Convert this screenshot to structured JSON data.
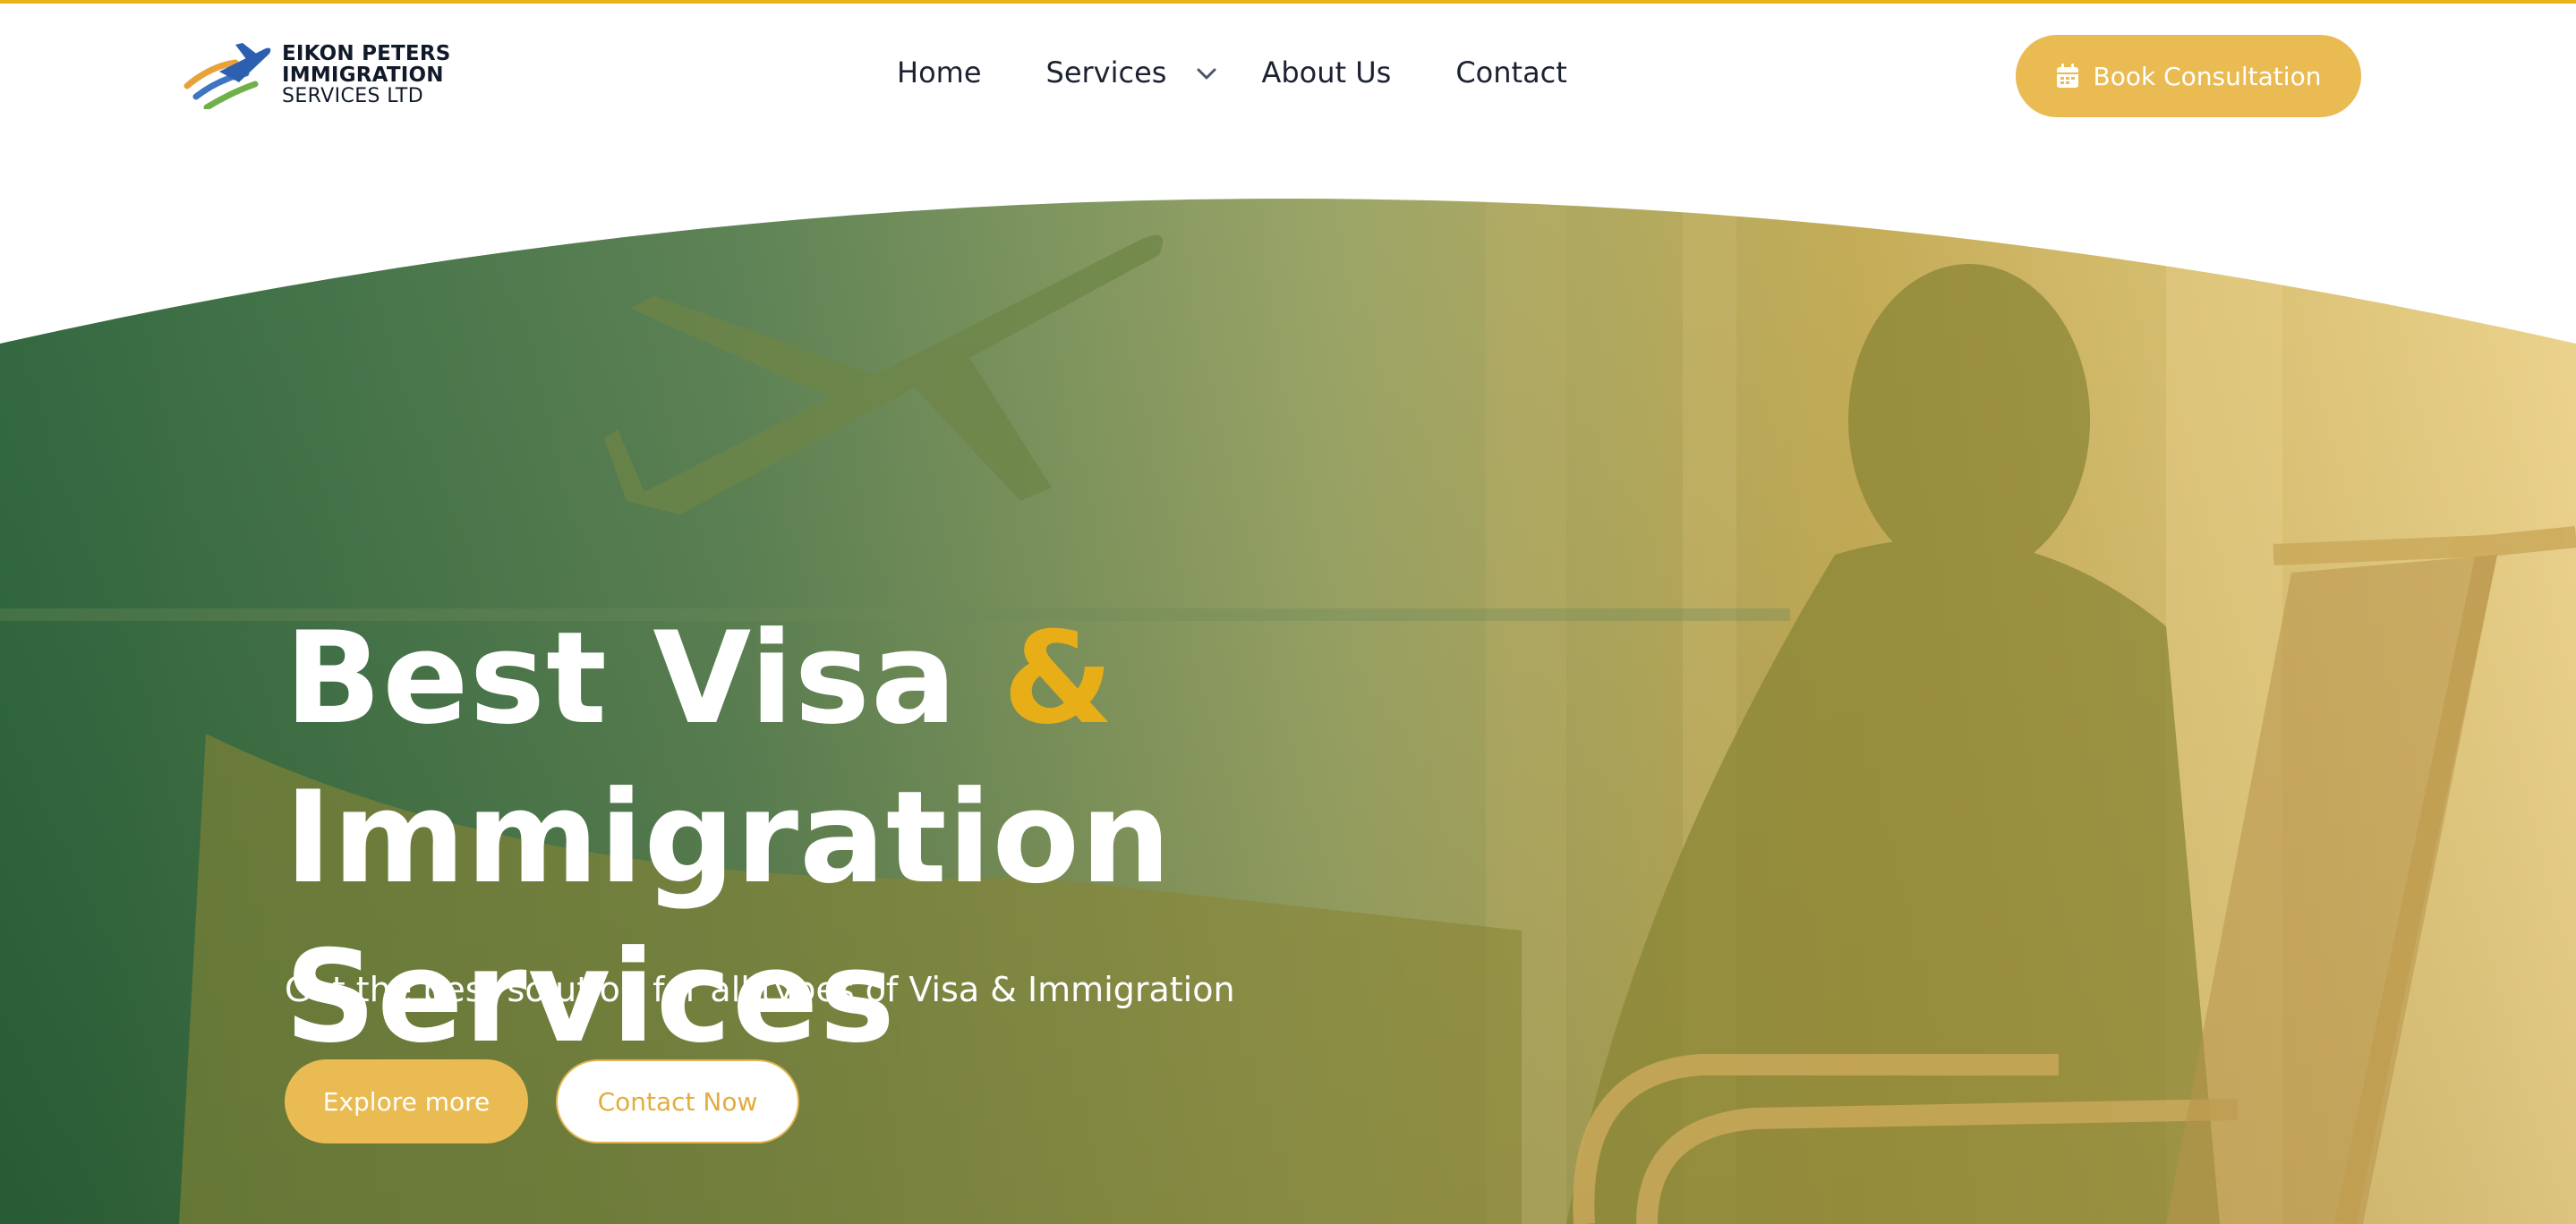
{
  "brand": {
    "line1": "EIKON PETERS",
    "line2": "IMMIGRATION",
    "line3": "SERVICES LTD",
    "logo_icon": "airplane-swoosh-logo"
  },
  "nav": {
    "home": "Home",
    "services": "Services",
    "about": "About Us",
    "contact": "Contact",
    "services_icon": "chevron-down-icon"
  },
  "cta": {
    "book_label": "Book Consultation",
    "book_icon": "calendar-icon"
  },
  "hero": {
    "title_part1": "Best Visa ",
    "title_amp": "&",
    "title_part2": " Immigration",
    "title_line2": "Services",
    "subtitle": "Get the best solution for all types of Visa & Immigration",
    "explore_label": "Explore more",
    "contact_label": "Contact Now",
    "image_description_icon": "traveler-airport-photo"
  },
  "colors": {
    "accent": "#e8b31d",
    "button": "#e9bb52",
    "green": "#2a6a3e",
    "text_dark": "#1b2231"
  }
}
